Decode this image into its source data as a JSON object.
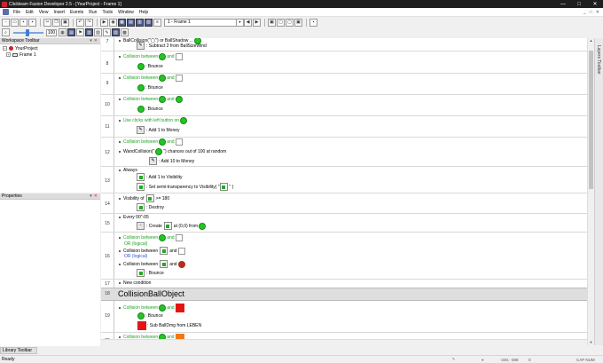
{
  "window": {
    "title": "Clickteam Fusion Developer 2.5 - [YourProject - Frame 1]",
    "minimize": "—",
    "maximize": "□",
    "close": "✕"
  },
  "menu": {
    "items": [
      "File",
      "Edit",
      "View",
      "Insert",
      "Events",
      "Run",
      "Tools",
      "Window",
      "Help"
    ],
    "right": [
      "_",
      "□",
      "✕"
    ]
  },
  "toolbar": {
    "frame_select": "1 - Frame 1",
    "zoom": "100"
  },
  "workspace": {
    "header": "Workspace Toolbar",
    "project": "YourProject",
    "frame": "Frame 1"
  },
  "properties": {
    "header": "Properties"
  },
  "library": {
    "tab": "Library Toolbar"
  },
  "right_toolbar": {
    "label": "Layers Toolbar"
  },
  "status": {
    "text": "Ready",
    "coords": "-240, -308",
    "zero": "0",
    "caps": "CAP NUM"
  },
  "events": {
    "r7_line": "BallCollision(\"◯\") or BallShadow ...",
    "r7_action": ": Subtract 2 from BallSizeWind",
    "collision_between": "Collision between",
    "and": "and",
    "bounce": ": Bounce",
    "use_clicks": "Use clicks with left button on",
    "add1money": ": Add 1 to Money",
    "r12_line2a": "WandCollision(\"",
    "r12_line2b": "\") chances out of 100 at random",
    "add10money": ": Add 10 to Money",
    "always": "Always",
    "add1vis": ": Add 1 to Visibility",
    "set_semi": ": Set semi-transparency to Visibility( \"",
    "set_semi_end": "\" )",
    "visibility_of": "Visibility of",
    "gte": ">= 180",
    "destroy": ": Destroy",
    "every": "Every 00\"-05",
    "create": ": Create",
    "create_at": "at (0,0) from",
    "or_logical": "OR (logical)",
    "new_condition": "New condition",
    "group_title": "CollisionBallObject",
    "sub_ballhp": ": Sub BallDmg from LEBEN",
    "row_numbers": [
      "7",
      "8",
      "9",
      "10",
      "11",
      "12",
      "13",
      "14",
      "15",
      "16",
      "17",
      "18",
      "19",
      "20"
    ]
  }
}
